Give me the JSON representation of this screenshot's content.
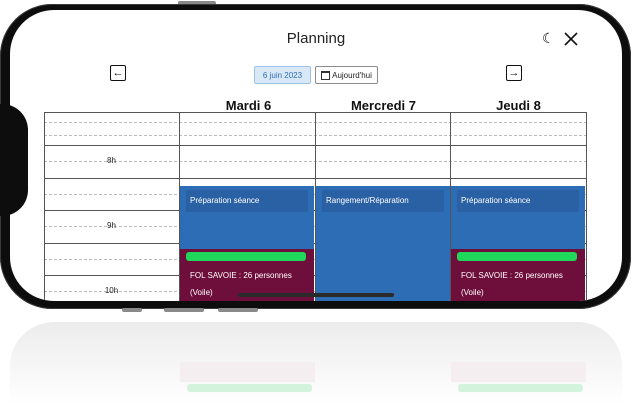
{
  "header": {
    "title": "Planning",
    "current_date": "6 juin 2023",
    "today_label": "Aujourd'hui",
    "prev_icon": "arrow-left-icon",
    "next_icon": "arrow-right-icon",
    "theme_icon": "moon-icon",
    "close_icon": "close-icon"
  },
  "days": [
    {
      "label": "Mardi 6"
    },
    {
      "label": "Mercredi 7"
    },
    {
      "label": "Jeudi 8"
    }
  ],
  "hours": [
    "8h",
    "9h",
    "10h"
  ],
  "events": {
    "mardi_blue": "Préparation séance",
    "mercredi_blue": "Rangement/Réparation",
    "jeudi_blue": "Préparation séance",
    "mardi_red_line1": "FOL SAVOIE : 26 personnes",
    "mardi_red_line2": "(Voile)",
    "jeudi_red_line1": "FOL SAVOIE : 26 personnes",
    "jeudi_red_line2": "(Voile)"
  },
  "colors": {
    "event_blue": "#2c6db5",
    "event_red": "#6e0e3a",
    "status_green": "#1fd75a",
    "date_pill": "#d9e8f7"
  }
}
